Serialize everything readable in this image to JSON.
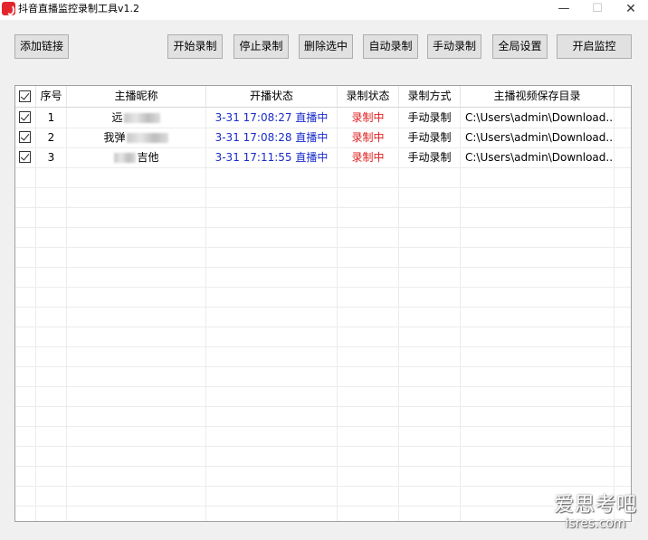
{
  "window": {
    "title": "抖音直播监控录制工具v1.2",
    "minimize": "—",
    "maximize": "☐",
    "close": "✕"
  },
  "toolbar": {
    "add_link": "添加链接",
    "start_record": "开始录制",
    "stop_record": "停止录制",
    "delete_selected": "删除选中",
    "auto_record": "自动录制",
    "manual_record": "手动录制",
    "global_settings": "全局设置",
    "start_monitor": "开启监控"
  },
  "table": {
    "columns": {
      "select": "☑",
      "index": "序号",
      "streamer": "主播昵称",
      "live_status": "开播状态",
      "record_status": "录制状态",
      "record_mode": "录制方式",
      "save_dir": "主播视频保存目录"
    },
    "rows": [
      {
        "checked": true,
        "index": "1",
        "name_prefix": "远",
        "name_suffix": "",
        "time": "3-31 17:08:27",
        "live": "直播中",
        "record_status": "录制中",
        "record_mode": "手动录制",
        "save_dir": "C:\\Users\\admin\\Download..."
      },
      {
        "checked": true,
        "index": "2",
        "name_prefix": "我弹",
        "name_suffix": "",
        "time": "3-31 17:08:28",
        "live": "直播中",
        "record_status": "录制中",
        "record_mode": "手动录制",
        "save_dir": "C:\\Users\\admin\\Download..."
      },
      {
        "checked": true,
        "index": "3",
        "name_prefix": "",
        "name_suffix": "吉他",
        "time": "3-31 17:11:55",
        "live": "直播中",
        "record_status": "录制中",
        "record_mode": "手动录制",
        "save_dir": "C:\\Users\\admin\\Download..."
      }
    ]
  },
  "watermark": {
    "main": "爱思考吧",
    "sub": "isres.com"
  },
  "colors": {
    "live_time": "#1a2cc9",
    "record_status": "#e02020",
    "app_icon": "#e3262e"
  }
}
